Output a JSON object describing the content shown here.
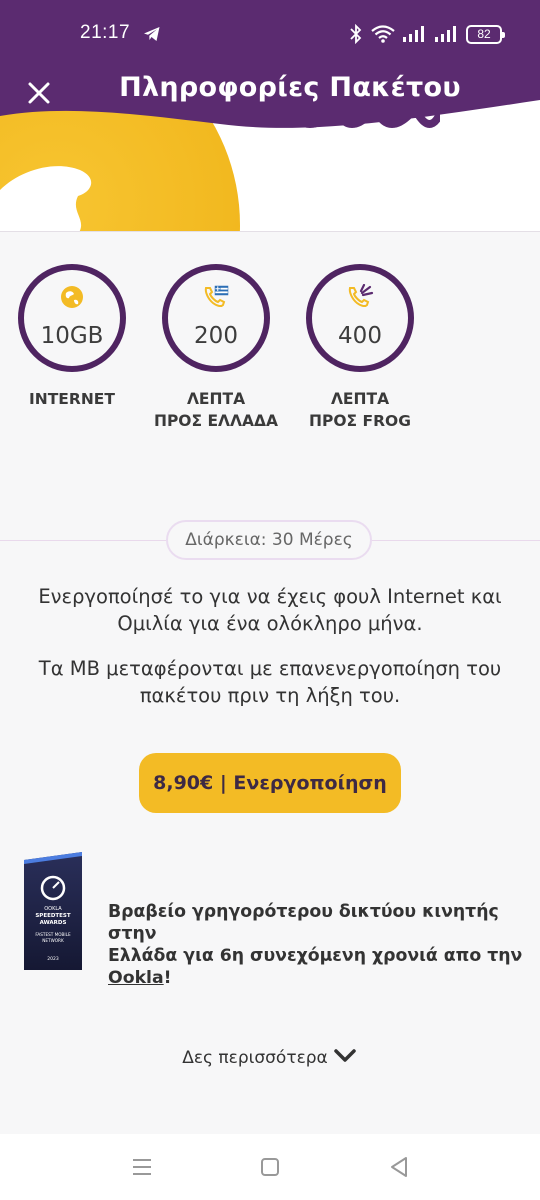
{
  "colors": {
    "brand_purple": "#5b2b70",
    "accent_yellow": "#f3bb25",
    "ring_purple": "#4f2461"
  },
  "status_bar": {
    "time": "21:17",
    "battery": "82"
  },
  "header": {
    "title": "Πληροφορίες Πακέτου"
  },
  "stats": [
    {
      "icon": "globe-icon",
      "value": "10GB",
      "label_line1": "INTERNET",
      "label_line2": ""
    },
    {
      "icon": "phone-greek-flag-icon",
      "value": "200",
      "label_line1": "ΛΕΠΤΑ",
      "label_line2": "ΠΡΟΣ ΕΛΛΑΔΑ"
    },
    {
      "icon": "phone-frog-icon",
      "value": "400",
      "label_line1": "ΛΕΠΤΑ",
      "label_line2": "ΠΡΟΣ FROG"
    }
  ],
  "duration": "Διάρκεια: 30 Μέρες",
  "description": {
    "p1_line1": "Ενεργοποίησέ το για να έχεις φουλ Internet και",
    "p1_line2": "Ομιλία για ένα ολόκληρο μήνα.",
    "p2_line1": "Τα MB μεταφέρονται με επανενεργοποίηση του",
    "p2_line2": "πακέτου πριν τη λήξη του."
  },
  "cta": {
    "label": "8,90€ | Ενεργοποίηση"
  },
  "award": {
    "badge_brand": "OOKLA",
    "badge_line1": "SPEEDTEST",
    "badge_line2": "AWARDS",
    "badge_line3": "FASTEST MOBILE",
    "badge_line4": "NETWORK",
    "badge_year": "2023",
    "text_line1": "Βραβείο γρηγορότερου δικτύου κινητής στην",
    "text_line2": "Ελλάδα για 6η συνεχόμενη χρονιά απο την",
    "link": "Ookla",
    "text_after_link": "!"
  },
  "see_more": "Δες περισσότερα"
}
